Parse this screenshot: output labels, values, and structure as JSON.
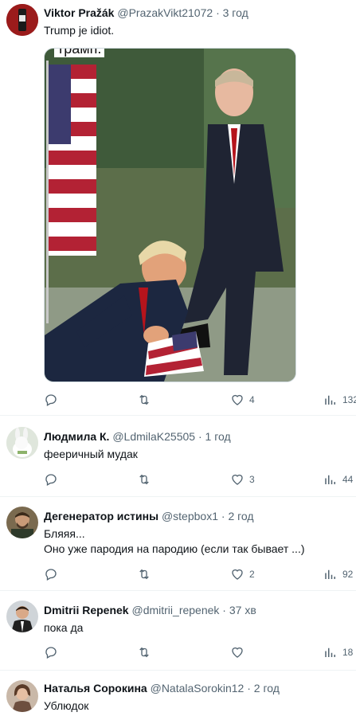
{
  "tweets": [
    {
      "name": "Viktor Pražák",
      "handle": "@PrazakVikt21072",
      "dot": "·",
      "time": "3 год",
      "text": [
        "Trump je idiot."
      ],
      "media_caption": "трамп.",
      "counts": {
        "reply": "",
        "retweet": "",
        "like": "4",
        "views": "132"
      }
    },
    {
      "name": "Людмила К.",
      "handle": "@LdmilaK25505",
      "dot": "·",
      "time": "1 год",
      "text": [
        "фееричный мудак"
      ],
      "counts": {
        "reply": "",
        "retweet": "",
        "like": "3",
        "views": "44"
      }
    },
    {
      "name": "Дегенератор истины",
      "handle": "@stepbox1",
      "dot": "·",
      "time": "2 год",
      "text": [
        "Бляяя...",
        "Оно уже пародия на пародию (если так бывает ...)"
      ],
      "counts": {
        "reply": "",
        "retweet": "",
        "like": "2",
        "views": "92"
      }
    },
    {
      "name": "Dmitrii Repenek",
      "handle": "@dmitrii_repenek",
      "dot": "·",
      "time": "37 хв",
      "text": [
        "пока да"
      ],
      "counts": {
        "reply": "",
        "retweet": "",
        "like": "",
        "views": "18"
      }
    },
    {
      "name": "Наталья Сорокина",
      "handle": "@NatalaSorokin12",
      "dot": "·",
      "time": "2 год",
      "text": [
        "Ублюдок"
      ]
    }
  ],
  "icons": {
    "reply": "reply-icon",
    "retweet": "retweet-icon",
    "like": "like-icon",
    "views": "views-icon"
  },
  "colors": {
    "text": "#0f1419",
    "secondary": "#536471",
    "divider": "#eff3f4"
  }
}
